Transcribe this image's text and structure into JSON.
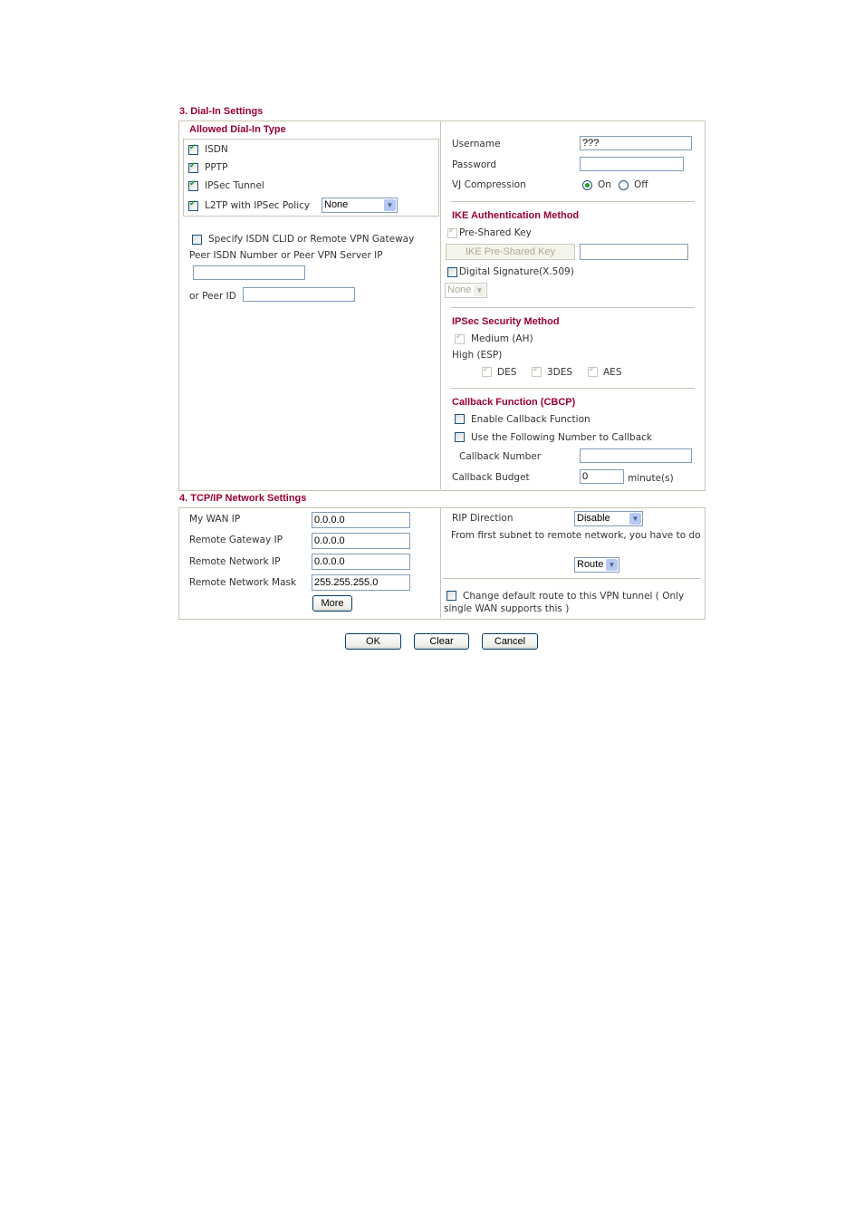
{
  "dial_in": {
    "section_title": "3. Dial-In Settings",
    "allowed_type": {
      "title": "Allowed Dial-In Type",
      "items": [
        {
          "label": "ISDN",
          "checked": true
        },
        {
          "label": "PPTP",
          "checked": true
        },
        {
          "label": "IPSec Tunnel",
          "checked": true
        },
        {
          "label": "L2TP with IPSec Policy",
          "checked": true
        }
      ],
      "l2tp_policy_value": "None"
    },
    "specify_clid": {
      "label": "Specify ISDN CLID or Remote VPN Gateway",
      "checked": false
    },
    "peer_isdn_label": "Peer ISDN Number or Peer VPN Server IP",
    "peer_isdn_value": "",
    "peer_id_label": "or Peer ID",
    "peer_id_value": "",
    "username_label": "Username",
    "username_value": "???",
    "password_label": "Password",
    "password_value": "",
    "vj_label": "VJ Compression",
    "vj_on_label": "On",
    "vj_off_label": "Off",
    "vj_selected": "On",
    "ike": {
      "title": "IKE Authentication Method",
      "pre_shared_label": "Pre-Shared Key",
      "pre_shared_checked": true,
      "ike_key_button": "IKE Pre-Shared Key",
      "ike_key_value": "",
      "digital_sig_label": "Digital Signature(X.509)",
      "digital_sig_checked": false,
      "cert_select_value": "None"
    },
    "ipsec": {
      "title": "IPSec Security Method",
      "medium_label": "Medium (AH)",
      "high_label": "High (ESP)",
      "des_label": "DES",
      "3des_label": "3DES",
      "aes_label": "AES"
    },
    "callback": {
      "title": "Callback Function (CBCP)",
      "enable_label": "Enable Callback Function",
      "use_number_label": "Use the Following Number to Callback",
      "number_label": "Callback Number",
      "number_value": "",
      "budget_label": "Callback Budget",
      "budget_value": "0",
      "budget_unit": "minute(s)"
    }
  },
  "tcpip": {
    "section_title": "4. TCP/IP Network Settings",
    "my_wan_ip_label": "My WAN IP",
    "my_wan_ip_value": "0.0.0.0",
    "remote_gw_label": "Remote Gateway IP",
    "remote_gw_value": "0.0.0.0",
    "remote_net_label": "Remote Network IP",
    "remote_net_value": "0.0.0.0",
    "remote_mask_label": "Remote Network Mask",
    "remote_mask_value": "255.255.255.0",
    "more_button": "More",
    "rip_label": "RIP Direction",
    "rip_value": "Disable",
    "subnet_text": "From first subnet to remote network, you have to do",
    "subnet_mode_value": "Route",
    "default_route_label": "Change default route to this VPN tunnel ( Only single WAN supports this )",
    "default_route_checked": false
  },
  "actions": {
    "ok": "OK",
    "clear": "Clear",
    "cancel": "Cancel"
  }
}
